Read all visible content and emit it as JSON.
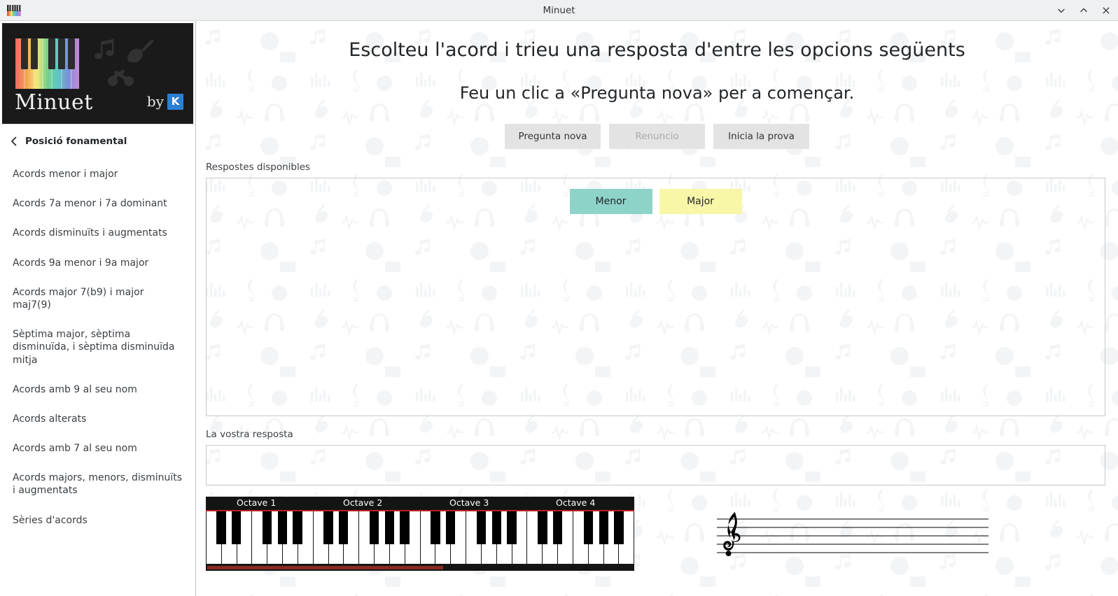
{
  "window": {
    "title": "Minuet",
    "app_icon": "piano-keys-icon",
    "controls": [
      {
        "name": "minimize",
        "icon": "chevron-down-icon"
      },
      {
        "name": "maximize",
        "icon": "chevron-up-icon"
      },
      {
        "name": "close",
        "icon": "close-icon"
      }
    ]
  },
  "sidebar": {
    "logo": {
      "wordmark": "Minuet",
      "by_label": "by",
      "kde_badge": "K"
    },
    "back_label": "Posició fonamental",
    "back_icon": "chevron-left-icon",
    "items": [
      {
        "label": "Acords menor i major"
      },
      {
        "label": "Acords 7a menor i 7a dominant"
      },
      {
        "label": "Acords disminuïts i augmentats"
      },
      {
        "label": "Acords 9a menor i 9a major"
      },
      {
        "label": "Acords major 7(b9) i major maj7(9)"
      },
      {
        "label": "Sèptima major, sèptima disminuïda, i sèptima disminuïda mitja"
      },
      {
        "label": "Acords amb 9 al seu nom"
      },
      {
        "label": "Acords alterats"
      },
      {
        "label": "Acords amb 7 al seu nom"
      },
      {
        "label": "Acords majors, menors, disminuïts i augmentats"
      },
      {
        "label": "Sèries d'acords"
      }
    ]
  },
  "main": {
    "heading": "Escolteu l'acord i trieu una resposta d'entre les opcions següents",
    "subheading": "Feu un clic a «Pregunta nova» per a començar.",
    "toolbar": [
      {
        "label": "Pregunta nova",
        "disabled": false
      },
      {
        "label": "Renuncio",
        "disabled": true
      },
      {
        "label": "Inicia la prova",
        "disabled": false
      }
    ],
    "answers_label": "Respostes disponibles",
    "answers": [
      {
        "label": "Menor",
        "color": "#8ed3c7"
      },
      {
        "label": "Major",
        "color": "#f8f7a8"
      }
    ],
    "response_label": "La vostra resposta",
    "response_value": ""
  },
  "piano": {
    "octaves": [
      "Octave 1",
      "Octave 2",
      "Octave 3",
      "Octave 4"
    ],
    "white_key_count": 28,
    "accent_line_color": "#c0201f",
    "scroll_position_percent": 55
  },
  "staff": {
    "clef": "treble-clef",
    "line_count": 5,
    "notes": []
  }
}
